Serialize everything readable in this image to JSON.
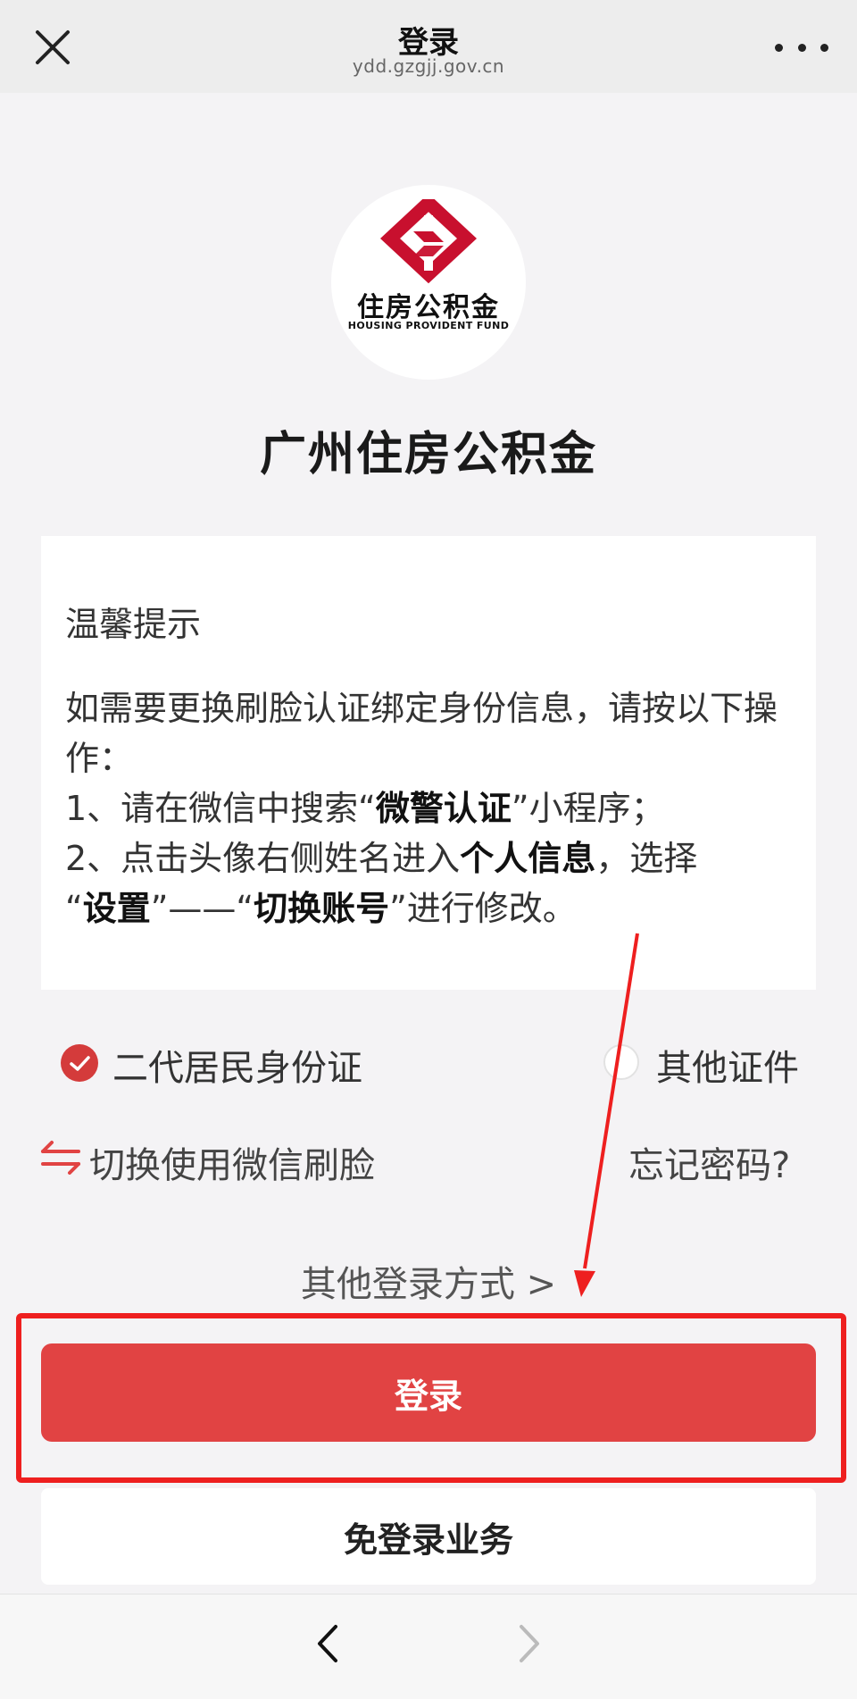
{
  "header": {
    "title": "登录",
    "domain": "ydd.gzgjj.gov.cn",
    "close_icon": "close-icon",
    "more_icon": "more-icon"
  },
  "logo": {
    "cn_text": "住房公积金",
    "en_text": "HOUSING PROVIDENT FUND",
    "brand_color": "#c8102e"
  },
  "site_name": "广州住房公积金",
  "notice": {
    "title": "温馨提示",
    "line1": "如需要更换刷脸认证绑定身份信息，请按以下操作：",
    "line2_prefix": "1、请在微信中搜索“",
    "line2_bold": "微警认证",
    "line2_suffix": "”小程序；",
    "line3_prefix": "2、点击头像右侧姓名进入",
    "line3_bold": "个人信息",
    "line3_suffix": "，选择",
    "line4_q1": "“",
    "line4_bold1": "设置",
    "line4_mid": "”——“",
    "line4_bold2": "切换账号",
    "line4_suffix": "”进行修改。"
  },
  "id_options": {
    "option1": "二代居民身份证",
    "option1_selected": true,
    "option2": "其他证件",
    "option2_selected": false
  },
  "links": {
    "switch_face": "切换使用微信刷脸",
    "forgot_password": "忘记密码?",
    "other_login": "其他登录方式 >"
  },
  "buttons": {
    "login": "登录",
    "no_login": "免登录业务"
  },
  "colors": {
    "accent": "#e14343",
    "highlight": "#ee1f1f"
  }
}
